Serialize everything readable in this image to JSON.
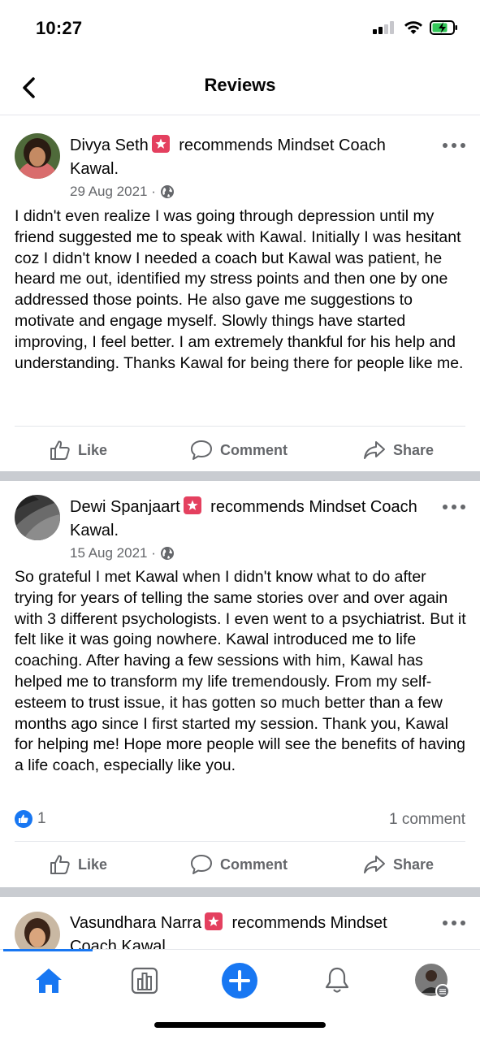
{
  "status_bar": {
    "time": "10:27"
  },
  "nav": {
    "title": "Reviews"
  },
  "reviews": [
    {
      "author": "Divya Seth",
      "recommends_text": " recommends ",
      "page_name": "Mindset Coach Kawal",
      "page_suffix": ".",
      "date": "29 Aug 2021 ·",
      "body": "I didn't even realize I was going through depression until my friend suggested me to speak with Kawal. Initially I was hesitant coz I didn't know I needed a coach but Kawal was patient, he heard me out, identified my stress points and then one by one addressed those points. He also gave me suggestions to motivate and engage myself. Slowly things have started improving, I feel better. I am extremely thankful for his help and understanding. Thanks Kawal for being there for people like me."
    },
    {
      "author": "Dewi Spanjaart",
      "recommends_text": " recommends ",
      "page_name": "Mindset Coach Kawal",
      "page_suffix": ".",
      "date": "15 Aug 2021 ·",
      "body": "So grateful I met Kawal when I didn't know what to do after trying for years of telling the same stories over and over again with 3 different psychologists. I even went to a psychiatrist. But it felt like it was going nowhere. Kawal introduced me to life coaching. After having a few sessions with him, Kawal has helped me to transform my life tremendously. From my self-esteem to trust issue, it has gotten so much better than a few months ago since I first started my session. Thank you, Kawal for helping me! Hope more people will see the benefits of having a life coach, especially like you.",
      "reaction_count": "1",
      "comment_count": "1 comment"
    },
    {
      "author": "Vasundhara Narra",
      "recommends_text": " recommends ",
      "page_name": "Mindset Coach Kawal",
      "page_suffix": ""
    }
  ],
  "actions": {
    "like": "Like",
    "comment": "Comment",
    "share": "Share"
  },
  "tab_bar": {
    "items": [
      "home-icon",
      "pages-insights-icon",
      "create-icon",
      "notifications-icon",
      "profile-avatar"
    ],
    "active": "home-icon",
    "accent": "#1877f2"
  },
  "colors": {
    "accent": "#1877f2",
    "recommend_badge": "#e4405f",
    "secondary_text": "#65676b"
  }
}
